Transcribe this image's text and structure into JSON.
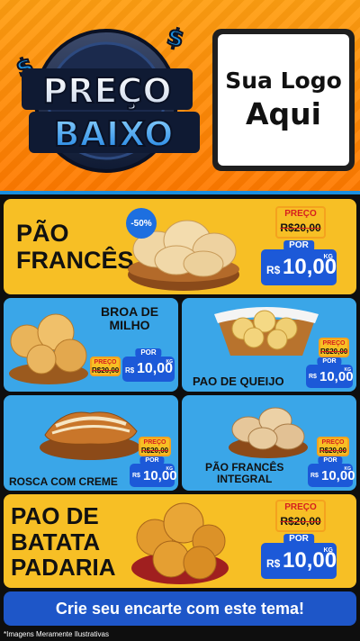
{
  "header": {
    "badge_line1": "PREÇO",
    "badge_line2": "BAIXO",
    "logo_line1": "Sua Logo",
    "logo_line2": "Aqui"
  },
  "products": [
    {
      "id": "pao-frances",
      "name_lines": [
        "PÃO",
        "FRANCÊS"
      ],
      "discount": "-50%",
      "old_label": "PREÇO",
      "old_value": "R$20,00",
      "new_label": "POR",
      "currency": "R$",
      "amount": "10,00",
      "unit": "KG"
    },
    {
      "id": "broa-de-milho",
      "name_lines": [
        "BROA DE",
        "MILHO"
      ],
      "old_label": "PREÇO",
      "old_value": "R$20,00",
      "new_label": "POR",
      "currency": "R$",
      "amount": "10,00",
      "unit": "KG"
    },
    {
      "id": "pao-de-queijo",
      "name_lines": [
        "PAO DE QUEIJO"
      ],
      "old_label": "PREÇO",
      "old_value": "R$20,00",
      "new_label": "POR",
      "currency": "R$",
      "amount": "10,00",
      "unit": "KG"
    },
    {
      "id": "rosca-com-creme",
      "name_lines": [
        "ROSCA COM CREME"
      ],
      "old_label": "PREÇO",
      "old_value": "R$20,00",
      "new_label": "POR",
      "currency": "R$",
      "amount": "10,00",
      "unit": "KG"
    },
    {
      "id": "pao-frances-integral",
      "name_lines": [
        "PÃO FRANCÊS",
        "INTEGRAL"
      ],
      "old_label": "PREÇO",
      "old_value": "R$20,00",
      "new_label": "POR",
      "currency": "R$",
      "amount": "10,00",
      "unit": "KG"
    },
    {
      "id": "pao-de-batata",
      "name_lines": [
        "PAO DE",
        "BATATA",
        "PADARIA"
      ],
      "old_label": "PREÇO",
      "old_value": "R$20,00",
      "new_label": "POR",
      "currency": "R$",
      "amount": "10,00",
      "unit": "KG"
    }
  ],
  "cta": "Crie seu encarte com este tema!",
  "disclaimer": "*Imagens Meramente Ilustrativas",
  "colors": {
    "orange": "#ff8a00",
    "yellow": "#f7bf25",
    "blue_card": "#3aa6e8",
    "price_blue": "#1c59d8",
    "strike_red": "#d61f1f"
  }
}
